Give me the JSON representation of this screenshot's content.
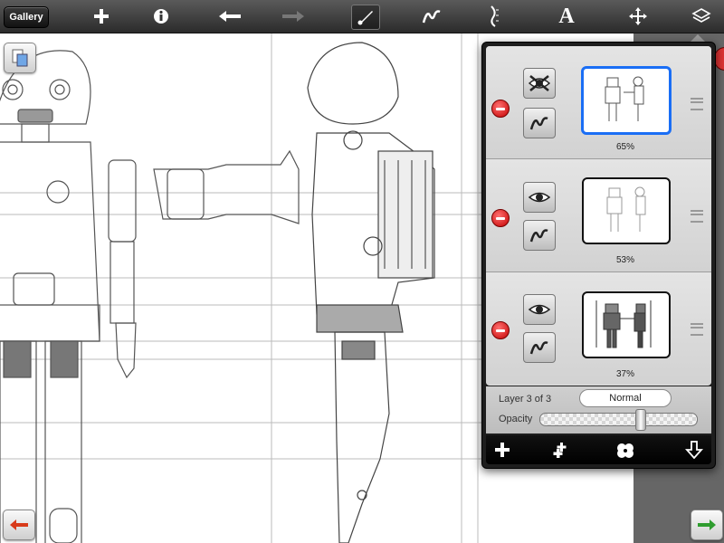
{
  "toolbar": {
    "gallery_label": "Gallery",
    "icons": [
      "plus-icon",
      "info-icon",
      "undo-icon",
      "redo-icon",
      "brush-icon",
      "pen-curve-icon",
      "ruler-icon",
      "text-icon",
      "move-arrows-icon",
      "layers-icon"
    ]
  },
  "layers_panel": {
    "layers": [
      {
        "visibility_icon": "eye-hidden-icon",
        "mode_icon": "pen-curve-icon",
        "opacity_label": "65%",
        "selected": true
      },
      {
        "visibility_icon": "eye-icon",
        "mode_icon": "pen-curve-icon",
        "opacity_label": "53%",
        "selected": false
      },
      {
        "visibility_icon": "eye-icon",
        "mode_icon": "pen-curve-icon",
        "opacity_label": "37%",
        "selected": false
      }
    ],
    "current_layer_text": "Layer 3 of 3",
    "blend_mode": "Normal",
    "opacity_label": "Opacity",
    "opacity_value": 0.65,
    "actions": [
      "add-layer-icon",
      "duplicate-layer-icon",
      "merge-layer-icon",
      "export-layer-icon"
    ]
  },
  "colors": {
    "toolbar_bg": "#3a3a3a",
    "selected_thumb_border": "#1a6ef5",
    "delete_button": "#d40000",
    "undo_arrow": "#d83a1a",
    "redo_arrow": "#2f9d2f"
  }
}
